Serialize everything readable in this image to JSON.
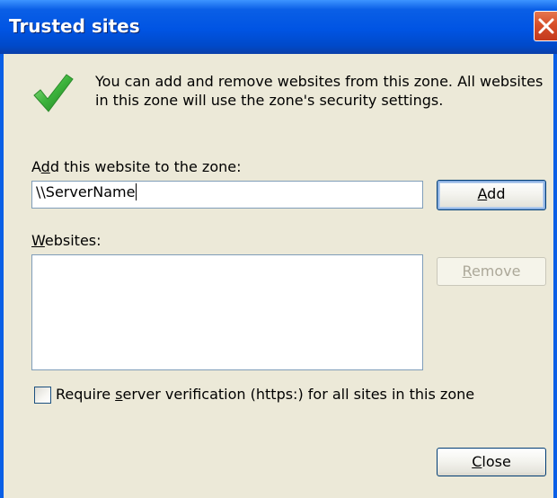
{
  "window": {
    "title": "Trusted sites"
  },
  "info": {
    "text": "You can add and remove websites from this zone. All websites in this zone will use the zone's security settings."
  },
  "add_site": {
    "label_pre": "A",
    "label_accel": "d",
    "label_post": "d this website to the zone:",
    "input_value": "\\\\ServerName",
    "button_accel": "A",
    "button_rest": "dd"
  },
  "websites": {
    "label_accel": "W",
    "label_rest": "ebsites:",
    "items": [],
    "remove_accel": "R",
    "remove_rest": "emove",
    "remove_enabled": false
  },
  "https_check": {
    "checked": false,
    "label_pre": "Require ",
    "label_accel": "s",
    "label_post": "erver verification (https:) for all sites in this zone"
  },
  "footer": {
    "close_accel": "C",
    "close_rest": "lose"
  },
  "icons": {
    "check": "check-icon",
    "close": "close-icon"
  },
  "colors": {
    "titlebar": "#0054e3",
    "close_button": "#d7502a",
    "dialog_bg": "#ece9d8",
    "check_green": "#3cb33c"
  }
}
